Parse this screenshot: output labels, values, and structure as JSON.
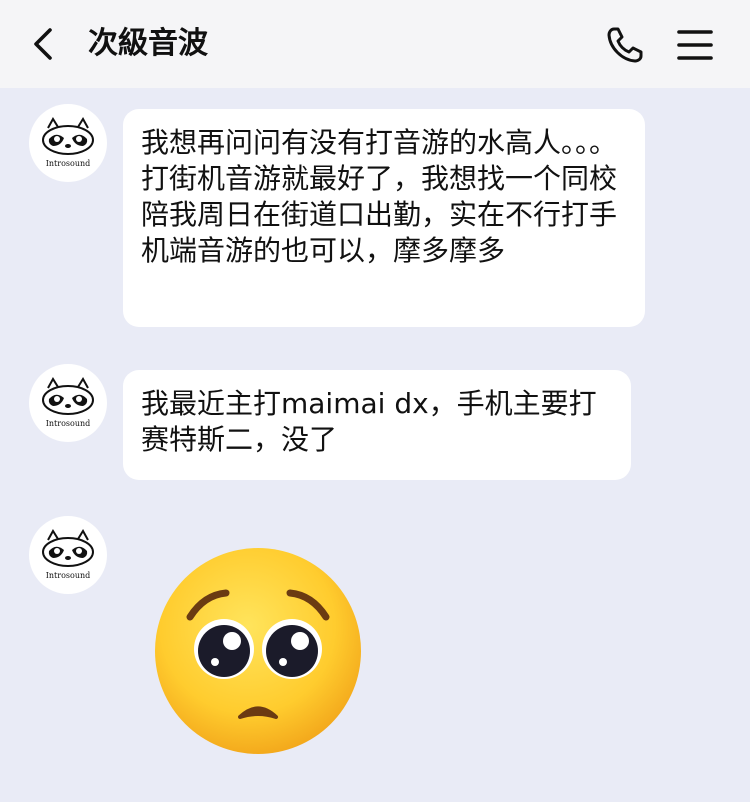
{
  "header": {
    "title": "次級音波",
    "back_icon": "chevron-left-icon",
    "call_icon": "phone-icon",
    "menu_icon": "hamburger-menu-icon"
  },
  "messages": [
    {
      "sender_avatar_text": "Introsound",
      "text": "我想再问问有没有打音游的水高人。。。打街机音游就最好了，我想找一个同校陪我周日在街道口出勤，实在不行打手机端音游的也可以，摩多摩多"
    },
    {
      "sender_avatar_text": "Introsound",
      "text": "我最近主打maimai dx，手机主要打赛特斯二，没了"
    },
    {
      "sender_avatar_text": "Introsound",
      "sticker": "pleading-face-emoji"
    }
  ],
  "colors": {
    "background": "#e9ebf6",
    "header_bg": "#f5f5f7",
    "bubble_bg": "#ffffff",
    "emoji_yellow": "#ffcc2e"
  }
}
